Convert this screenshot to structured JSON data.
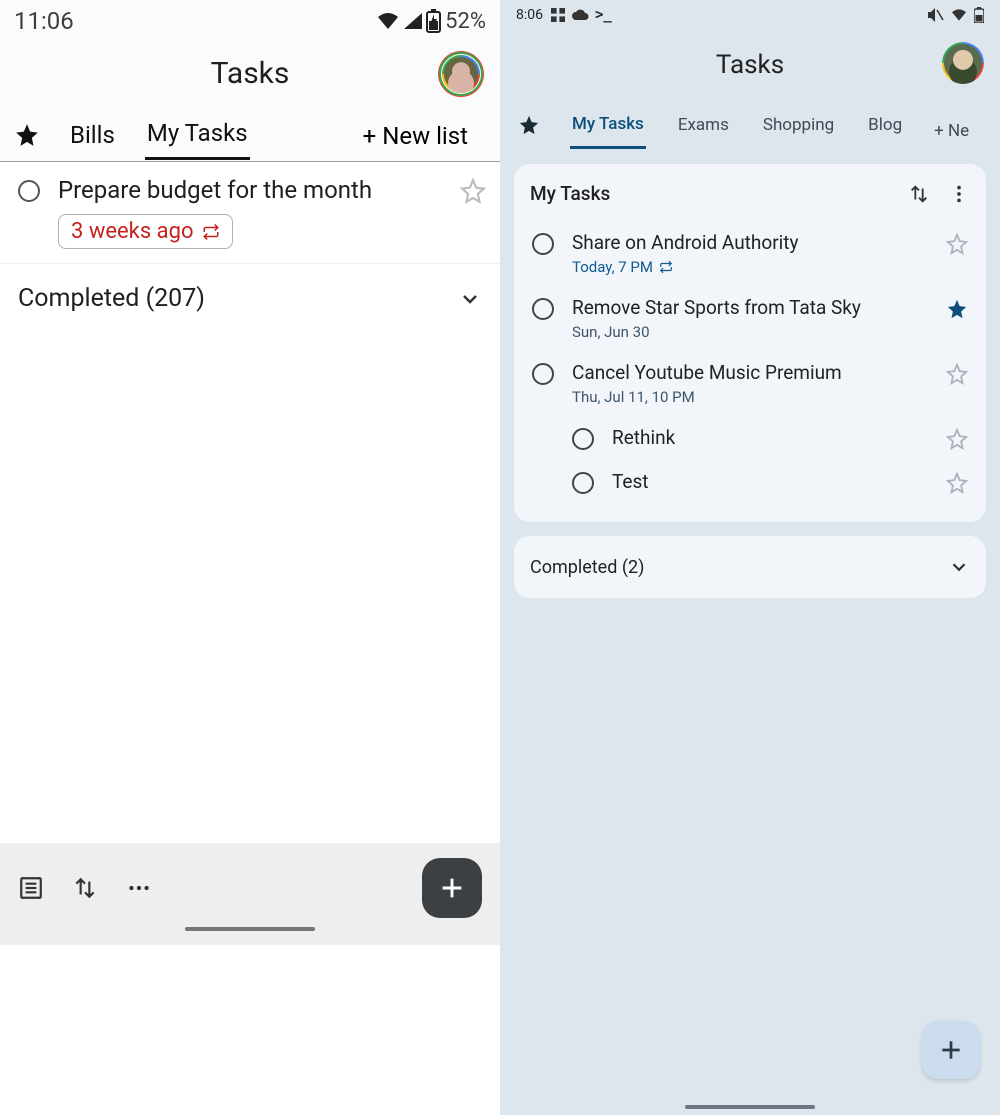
{
  "left": {
    "statusbar": {
      "time": "11:06",
      "battery": "52%"
    },
    "title": "Tasks",
    "tabs": [
      "Bills",
      "My Tasks"
    ],
    "active_tab": "My Tasks",
    "new_list": "+ New list",
    "task": {
      "title": "Prepare budget for the month",
      "date": "3 weeks ago"
    },
    "completed": "Completed (207)"
  },
  "right": {
    "statusbar": {
      "time": "8:06"
    },
    "title": "Tasks",
    "tabs": [
      "My Tasks",
      "Exams",
      "Shopping",
      "Blog"
    ],
    "active_tab": "My Tasks",
    "new_list": "+  Ne",
    "card_title": "My Tasks",
    "tasks": [
      {
        "title": "Share on Android Authority",
        "sub": "Today, 7 PM",
        "repeat": true,
        "starred": false,
        "accent": true
      },
      {
        "title": "Remove Star Sports from Tata Sky",
        "sub": "Sun, Jun 30",
        "repeat": false,
        "starred": true,
        "accent": false
      },
      {
        "title": "Cancel Youtube Music Premium",
        "sub": "Thu, Jul 11, 10 PM",
        "repeat": false,
        "starred": false,
        "accent": false
      }
    ],
    "subtasks": [
      "Rethink",
      "Test"
    ],
    "completed": "Completed (2)"
  }
}
